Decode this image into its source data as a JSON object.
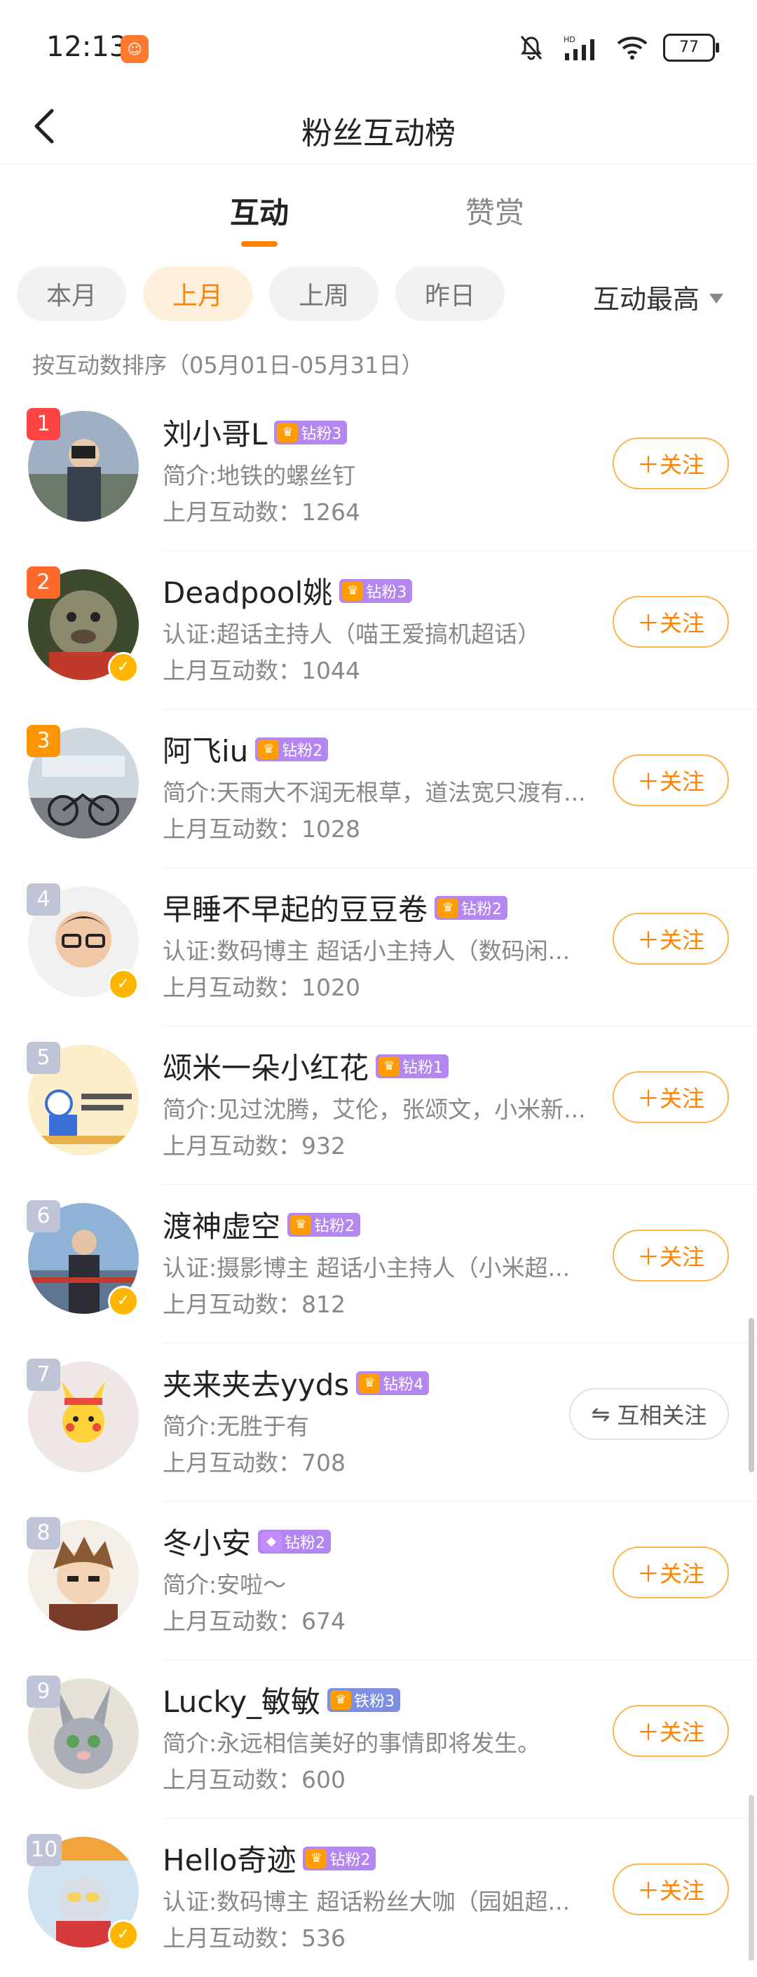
{
  "status_bar": {
    "time": "12:13",
    "app_icon": "weibo-app-icon",
    "icons": [
      "mute-bell-icon",
      "hd-signal-icon",
      "wifi-icon"
    ],
    "hd_label": "HD",
    "battery": "77"
  },
  "header": {
    "title": "粉丝互动榜",
    "back_icon": "chevron-left-icon"
  },
  "tabs": [
    {
      "label": "互动",
      "active": true
    },
    {
      "label": "赞赏",
      "active": false
    }
  ],
  "filters": {
    "chips": [
      "本月",
      "上月",
      "上周",
      "昨日"
    ],
    "selected": "上月",
    "sort_label": "互动最高"
  },
  "range_text": "按互动数排序（05月01日-05月31日）",
  "colors": {
    "accent": "#ff8200",
    "rank1": "#ff4444",
    "rank2": "#ff6a2b",
    "rank3": "#ff9500",
    "rank_other": "#bfc5d6"
  },
  "fans": [
    {
      "rank": "1",
      "name": "刘小哥L",
      "badge": "钻粉3",
      "bio": "简介:地铁的螺丝钉",
      "count": "上月互动数：1264",
      "verified": false,
      "action": "＋关注"
    },
    {
      "rank": "2",
      "name": "Deadpool姚",
      "badge": "钻粉3",
      "bio": "认证:超话主持人（喵王爱搞机超话）",
      "count": "上月互动数：1044",
      "verified": true,
      "action": "＋关注"
    },
    {
      "rank": "3",
      "name": "阿飞iu",
      "badge": "钻粉2",
      "bio": "简介:天雨大不润无根草，道法宽只渡有...",
      "count": "上月互动数：1028",
      "verified": false,
      "action": "＋关注"
    },
    {
      "rank": "4",
      "name": "早睡不早起的豆豆卷",
      "badge": "钻粉2",
      "bio": "认证:数码博主 超话小主持人（数码闲...",
      "count": "上月互动数：1020",
      "verified": true,
      "action": "＋关注"
    },
    {
      "rank": "5",
      "name": "颂米一朵小红花",
      "badge": "钻粉1",
      "bio": "简介:见过沈腾，艾伦，张颂文，小米新...",
      "count": "上月互动数：932",
      "verified": false,
      "action": "＋关注"
    },
    {
      "rank": "6",
      "name": "渡神虚空",
      "badge": "钻粉2",
      "bio": "认证:摄影博主 超话小主持人（小米超...",
      "count": "上月互动数：812",
      "verified": true,
      "action": "＋关注"
    },
    {
      "rank": "7",
      "name": "夹来夹去yyds",
      "badge": "钻粉4",
      "bio": "简介:无胜于有",
      "count": "上月互动数：708",
      "verified": false,
      "action": "互相关注"
    },
    {
      "rank": "8",
      "name": "冬小安",
      "badge": "钻粉2",
      "bio": "简介:安啦～",
      "count": "上月互动数：674",
      "verified": false,
      "action": "＋关注"
    },
    {
      "rank": "9",
      "name": "Lucky_敏敏",
      "badge": "铁粉3",
      "bio": "简介:永远相信美好的事情即将发生。",
      "count": "上月互动数：600",
      "verified": false,
      "action": "＋关注"
    },
    {
      "rank": "10",
      "name": "Hello奇迹",
      "badge": "钻粉2",
      "bio": "认证:数码博主 超话粉丝大咖（园姐超...",
      "count": "上月互动数：536",
      "verified": true,
      "action": "＋关注"
    }
  ]
}
